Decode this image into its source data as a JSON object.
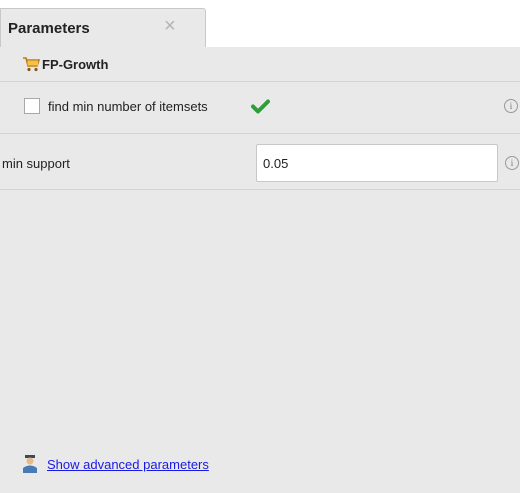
{
  "tab": {
    "title": "Parameters",
    "close_glyph": "×"
  },
  "operator": {
    "name": "FP-Growth",
    "icon": "shopping-cart-icon"
  },
  "parameters": [
    {
      "type": "checkbox",
      "label": "find min number of itemsets",
      "checked": false,
      "status_icon": "check-icon",
      "info_icon": "info-icon"
    },
    {
      "type": "text",
      "label": "min support",
      "value": "0.05",
      "info_icon": "info-icon"
    }
  ],
  "advanced": {
    "label": "Show advanced parameters",
    "icon": "user-icon"
  },
  "colors": {
    "panel": "#e8e9e8",
    "link": "#1a1ae6",
    "check": "#2e9e3a"
  }
}
